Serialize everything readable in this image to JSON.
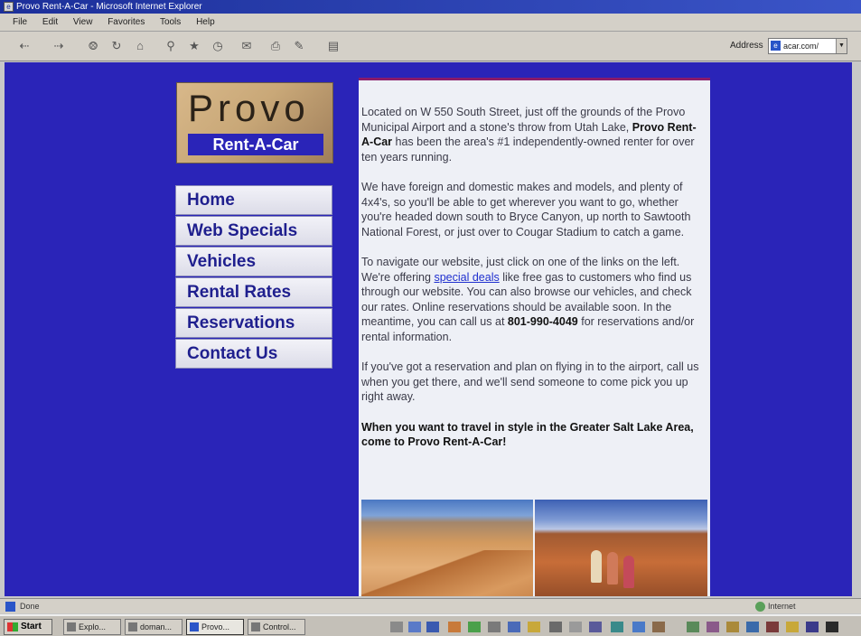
{
  "window": {
    "title": "Provo Rent-A-Car - Microsoft Internet Explorer"
  },
  "menu": [
    "File",
    "Edit",
    "View",
    "Favorites",
    "Tools",
    "Help"
  ],
  "toolbar": {
    "address_label": "Address",
    "address_value": "acar.com/"
  },
  "logo": {
    "name": "Provo",
    "tagline": "Rent-A-Car"
  },
  "nav": [
    {
      "label": "Home"
    },
    {
      "label": "Web Specials"
    },
    {
      "label": "Vehicles"
    },
    {
      "label": "Rental Rates"
    },
    {
      "label": "Reservations"
    },
    {
      "label": "Contact Us"
    }
  ],
  "content": {
    "p1_pre": "Located on W 550 South Street, just off the grounds of the Provo Municipal Airport and a stone's throw from Utah Lake, ",
    "p1_bold": "Provo Rent-A-Car",
    "p1_post": " has been the area's #1 independently-owned renter for over ten years running.",
    "p2": "We have foreign and domestic makes and models, and plenty of 4x4's, so you'll be able to get wherever you want to go, whether you're headed down south to Bryce Canyon, up north to Sawtooth National Forest, or just over to Cougar Stadium to catch a game.",
    "p3_pre": "To navigate our website, just click on one of the links on the left. We're offering ",
    "p3_link": "special deals",
    "p3_mid": " like free gas to customers who find us through our website. You can also browse our vehicles, and check our rates. Online reservations should be available soon. In the meantime, you can call us at ",
    "p3_phone": "801-990-4049",
    "p3_post": " for reservations and/or rental information.",
    "p4": "If you've got a reservation and plan on flying in to the airport, call us when you get there, and we'll send someone to come pick you up right away.",
    "p5": "When you want to travel in style in the Greater Salt Lake Area, come to Provo Rent-A-Car!"
  },
  "statusbar": {
    "status": "Done",
    "zone": "Internet"
  },
  "taskbar": {
    "start": "Start",
    "tasks": [
      "Explo...",
      "doman...",
      "Provo...",
      "Control..."
    ]
  }
}
